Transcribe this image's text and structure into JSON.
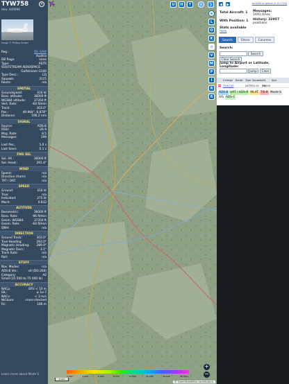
{
  "aircraft": {
    "callsign": "TYW758",
    "hex_line": "Hex: 440096",
    "photo_caption": "Image © Philipp Grabel"
  },
  "info_rows": [
    {
      "k": "Reg.:",
      "v": "OE-GAW",
      "link": true
    },
    {
      "k": "",
      "v": "Austria",
      "link": false
    },
    {
      "k": "DB flags:",
      "v": "none",
      "link": false
    },
    {
      "k": "Type:",
      "v": "ASTR",
      "link": false
    }
  ],
  "type_desc": {
    "k": "GULFSTREAM AEROSPACE",
    "v": "Gulfstream G100"
  },
  "info_rows2": [
    {
      "k": "Type Desc.:",
      "v": "L2J"
    },
    {
      "k": "Squawk:",
      "v": "3115"
    },
    {
      "k": "Route:",
      "v": "n/a"
    }
  ],
  "sections": {
    "spatial": "SPATIAL",
    "signal": "SIGNAL",
    "fms": "FMS SEL",
    "wind": "WIND",
    "speed": "SPEED",
    "altitude": "ALTITUDE",
    "direction": "DIRECTION",
    "stuff": "STUFF",
    "accuracy": "ACCURACY"
  },
  "spatial_rows": [
    {
      "k": "Groundspeed:",
      "v": "416 kt"
    },
    {
      "k": "Baro. altitude:",
      "v": "36000 ft"
    },
    {
      "k": "WGS84 altitude:",
      "v": "37350 ft"
    },
    {
      "k": "Vert. Rate:",
      "v": "-64 ft/min"
    },
    {
      "k": "Track:",
      "v": "303.0°"
    },
    {
      "k": "Pos.:",
      "v": "49.964°, 6.878°"
    },
    {
      "k": "Distance:",
      "v": "196.2 nmi"
    }
  ],
  "signal_rows": [
    {
      "k": "Source:",
      "v": "ADS-B"
    },
    {
      "k": "RSSI:",
      "v": "-26.9"
    },
    {
      "k": "Msg. Rate:",
      "v": "8.5"
    },
    {
      "k": "Messages:",
      "v": "199"
    },
    {
      "k": "",
      "v": ""
    },
    {
      "k": "Last Pos.:",
      "v": "5.0 s"
    },
    {
      "k": "Last Seen:",
      "v": "0.1 s"
    }
  ],
  "fms_rows": [
    {
      "k": "Sel. Alt.:",
      "v": "36000 ft"
    },
    {
      "k": "Sel. Head.:",
      "v": "291.8°"
    }
  ],
  "wind_rows": [
    {
      "k": "Speed:",
      "v": "n/a"
    },
    {
      "k": "Direction (from):",
      "v": "n/a"
    },
    {
      "k": "TAT / OAT:",
      "v": "n/a"
    }
  ],
  "speed_rows": [
    {
      "k": "Ground:",
      "v": "416 kt"
    },
    {
      "k": "True:",
      "v": "n/a"
    },
    {
      "k": "Indicated:",
      "v": "275 kt"
    },
    {
      "k": "Mach:",
      "v": "0.832"
    }
  ],
  "altitude_rows": [
    {
      "k": "Barometric:",
      "v": "36000 ft"
    },
    {
      "k": "Baro. Rate:",
      "v": "-96 ft/min"
    },
    {
      "k": "Geom. WGS84:",
      "v": "37350 ft"
    },
    {
      "k": "Geom. Rate:",
      "v": "-64 ft/min"
    },
    {
      "k": "QNH:",
      "v": "n/a"
    }
  ],
  "direction_rows": [
    {
      "k": "Ground Track:",
      "v": "303.0°"
    },
    {
      "k": "True Heading:",
      "v": "293.0°"
    },
    {
      "k": "Magnetic Heading:",
      "v": "289.9°"
    },
    {
      "k": "Magnetic Decl.:",
      "v": "3.1°"
    },
    {
      "k": "Track Rate:",
      "v": "n/a"
    },
    {
      "k": "Roll:",
      "v": "n/a"
    }
  ],
  "stuff_rows": [
    {
      "k": "Nav. Modes:",
      "v": "n/a"
    },
    {
      "k": "ADS-B Ver.:",
      "v": "v0 (DO-260)"
    },
    {
      "k": "Category:",
      "v": "A2"
    }
  ],
  "stuff_category_desc": "Small (15 500 to 75 000 lb)",
  "accuracy_rows": [
    {
      "k": "NACp:",
      "v": "EPU < 10 m"
    },
    {
      "k": "SIL:",
      "v": "≤ 1e-7"
    },
    {
      "k": "NACv:",
      "v": "< 3 m/s"
    },
    {
      "k": "NICbaro:",
      "v": "cross-checked"
    },
    {
      "k": "Rc:",
      "v": "186 m"
    }
  ],
  "footer_text": "Learn more about Mode S",
  "footer_text2": "hex type by hovering over",
  "footer_text3": "each table label",
  "map_buttons": {
    "u": "U",
    "h": "H",
    "t": "T"
  },
  "map_attribution": "© OpenStreetMap contributors.",
  "scale_label": "5 nmi",
  "altitude_scale": [
    "2 000",
    "4 000",
    "6 000",
    "8 000",
    "10 000",
    "20 000",
    "30 000",
    "40 000+"
  ],
  "rail_letters": [
    "L",
    "O",
    "K",
    "V",
    "M",
    "P",
    "I",
    "R",
    "R"
  ],
  "right": {
    "version_link": "tar1090 on github (3.14.1759)",
    "total_label": "Total Aircraft: 1",
    "withpos_label": "With Position: 1",
    "stats_label": "Stats available",
    "stats_link": "here",
    "messages_label": "Messages:",
    "messages_value": "1691.0/sec",
    "history_label": "History: 22957",
    "history_value": "positions",
    "tabs": [
      "Search",
      "Filters",
      "Columns"
    ],
    "search_label": "Search:",
    "search_button": "Search",
    "clear_search": "Clear Search",
    "jump_label": "Jump to Airport or Latitude, Longitude:",
    "jump_button": "Jump",
    "clear_button": "Clear",
    "table_headers": [
      "",
      "Callsign",
      "Route",
      "Type",
      "Squawk",
      "Alt. (ft)",
      "Spd."
    ],
    "table_row": [
      "",
      "TYW758",
      "",
      "ASTR",
      "3115",
      "36000",
      ""
    ],
    "badges": [
      {
        "text": "ADS-B",
        "color": "#a5d8ff"
      },
      {
        "text": "UAT / ADS-R",
        "color": "#b8f2a8"
      },
      {
        "text": "MLAT",
        "color": "#ffe38a"
      },
      {
        "text": "TIS-B",
        "color": "#ffb3b3"
      },
      {
        "text": "Mode-S",
        "color": "#e3e3e3"
      },
      {
        "text": "AIS",
        "color": "#ffffff"
      },
      {
        "text": "ADS-C",
        "color": "#c9f0c9"
      }
    ]
  }
}
